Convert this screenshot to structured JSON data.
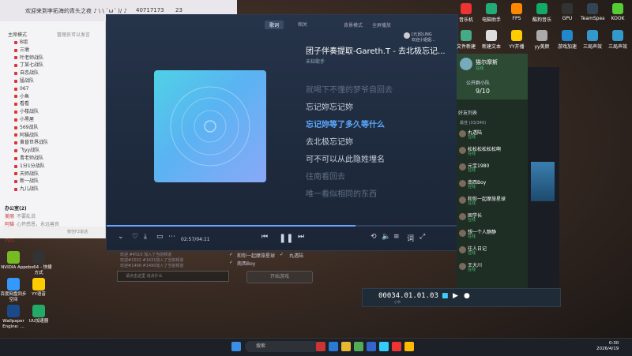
{
  "topbar": {
    "title": "欢迎来到李拓海的青头之夜 ♪ \\ \\ `ω´ )/ ♪",
    "id_a": "40717173",
    "id_b": "23"
  },
  "left_panel": {
    "header_left": "主席模式",
    "header_right": "管理员可以发言",
    "items": [
      "B组",
      "三墩",
      "叶老师战队",
      "丁某七战队",
      "自恋战队",
      "猛战队",
      "067",
      "小鱼",
      "看看",
      "小楼战队",
      "小黑屋",
      "569战队",
      "阿猫战队",
      "黄昏世界战队",
      "飞yy战队",
      "青老师战队",
      "1分1分战队",
      "天师战队",
      "新一战队",
      "九儿战队"
    ],
    "section": {
      "title": "办公室(2)",
      "rows": [
        {
          "name": "美丽",
          "badge": "不要乱说"
        },
        {
          "name": "阿猫",
          "badge": "心怀感恩，永远善良"
        },
        {
          "name": "天蝉鹤",
          "badge": ""
        },
        {
          "name": "九儿",
          "badge": ""
        }
      ]
    },
    "bottom_text": "按住F2说话"
  },
  "player": {
    "tab_lyrics": "歌词",
    "tab_related": "相关",
    "mode_label": "背景模式",
    "live_label": "全屏播放",
    "user_line1": "[元]伦LING",
    "user_line2": "欢迎小姐姐...",
    "song_title": "团子伴奏提取-Gareth.T - 去北极忘记...",
    "artist": "未知歌手",
    "lyrics": [
      {
        "text": "就喝下不懂的梦爷自回去",
        "state": "dim"
      },
      {
        "text": "忘记妳忘记妳",
        "state": "normal"
      },
      {
        "text": "忘记妳等了多久等什么",
        "state": "current"
      },
      {
        "text": "去北极忘记妳",
        "state": "normal"
      },
      {
        "text": "可不可以从此隐姓埋名",
        "state": "normal"
      },
      {
        "text": "往南看回去",
        "state": "dim"
      },
      {
        "text": "唯一看似相同的东西",
        "state": "dim"
      }
    ],
    "time": "02:57/04:11",
    "progress": 0.71
  },
  "chat": {
    "lines": [
      "欢迎 #4510 加入了当前频道",
      "欢迎#1502 #1631加入了当前频道",
      "欢迎#1498 #1490加入了当前频道"
    ],
    "input_placeholder": "请点击这里 说点什么"
  },
  "queue": {
    "items": [
      {
        "name": "和你一起摩旅星球",
        "who": "丸透陆"
      },
      {
        "name": "南西Boy",
        "who": ""
      }
    ],
    "start_button": "开始游戏"
  },
  "desktop_icons_top": [
    {
      "label": "音乐机",
      "color": "#e33"
    },
    {
      "label": "电脑助手",
      "color": "#2a7"
    },
    {
      "label": "FPS",
      "color": "#f80"
    },
    {
      "label": "酷狗音乐",
      "color": "#1a6"
    },
    {
      "label": "GPU",
      "color": "#333"
    },
    {
      "label": "TeamSpeak 3",
      "color": "#345"
    },
    {
      "label": "KOOK",
      "color": "#5c3"
    }
  ],
  "desktop_icons_row2": [
    {
      "label": "文件新建",
      "color": "#4a8"
    },
    {
      "label": "新建文本",
      "color": "#ddd"
    },
    {
      "label": "YY开播",
      "color": "#fc0"
    },
    {
      "label": "yy美颜",
      "color": "#aaa"
    },
    {
      "label": "游戏加速",
      "color": "#28c"
    },
    {
      "label": "三局声效",
      "color": "#39c"
    },
    {
      "label": "三局声效",
      "color": "#39c"
    }
  ],
  "right_app": {
    "name": "猫尔摩斯",
    "status": "在线",
    "channel": "公开群小队",
    "count": "9/10",
    "list_title": "好友列表",
    "group": "最佳 (33/340)",
    "friends": [
      {
        "name": "丸透陆",
        "status": "在线"
      },
      {
        "name": "松松松松松松啊",
        "status": "在线"
      },
      {
        "name": "元宝1980",
        "status": "在线"
      },
      {
        "name": "南西Boy",
        "status": "在线"
      },
      {
        "name": "和你一起摩旅星球",
        "status": "在线"
      },
      {
        "name": "困学长",
        "status": "在线"
      },
      {
        "name": "想一个人静静",
        "status": "在线"
      },
      {
        "name": "往人日记",
        "status": "在线"
      },
      {
        "name": "王大川",
        "status": "在线"
      }
    ]
  },
  "transport": {
    "timecode": "00034.01.01.03",
    "sub": "小节"
  },
  "left_desktop": [
    {
      "label": "NVIDIA App",
      "color": "#7b2"
    },
    {
      "label": "obs64 - 快捷方式",
      "color": "#333"
    },
    {
      "label": "百度网盘同步空间",
      "color": "#39f"
    },
    {
      "label": "YY语音",
      "color": "#fc0"
    },
    {
      "label": "Wallpaper Engine: ...",
      "color": "#1a4a8a"
    },
    {
      "label": "UU加速器",
      "color": "#2a6"
    }
  ],
  "taskbar": {
    "search": "搜索",
    "time": "0:30",
    "date": "2026/4/19"
  }
}
